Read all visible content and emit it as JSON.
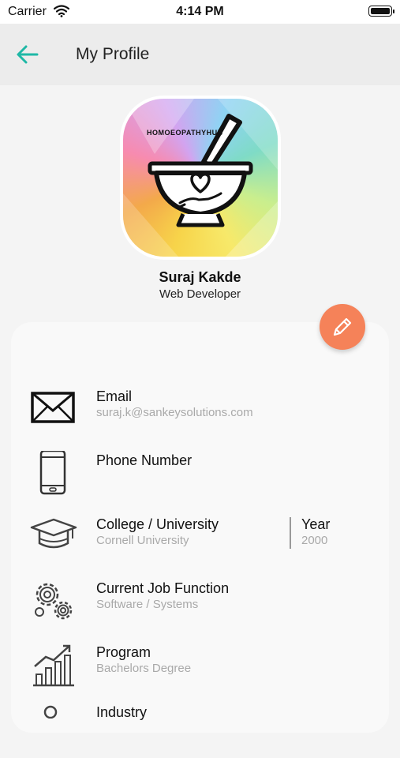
{
  "status_bar": {
    "carrier": "Carrier",
    "time": "4:14 PM"
  },
  "header": {
    "title": "My Profile",
    "back_icon": "arrow-left-icon",
    "accent_color": "#1fb8a6"
  },
  "profile": {
    "logo_text": "HOMOEOPATHYHUB",
    "name": "Suraj Kakde",
    "role": "Web Developer",
    "edit_icon": "pencil-icon",
    "edit_button_color": "#f58259"
  },
  "fields": {
    "email": {
      "label": "Email",
      "value": "suraj.k@sankeysolutions.com",
      "icon": "envelope-icon"
    },
    "phone": {
      "label": "Phone Number",
      "value": "",
      "icon": "smartphone-icon"
    },
    "college": {
      "label": "College / University",
      "value": "Cornell University",
      "icon": "graduation-cap-icon"
    },
    "year": {
      "label": "Year",
      "value": "2000"
    },
    "job": {
      "label": "Current Job Function",
      "value": "Software / Systems",
      "icon": "gears-icon"
    },
    "program": {
      "label": "Program",
      "value": "Bachelors Degree",
      "icon": "growth-chart-icon"
    },
    "next": {
      "label": "Industry",
      "icon": "location-pin-icon"
    }
  }
}
